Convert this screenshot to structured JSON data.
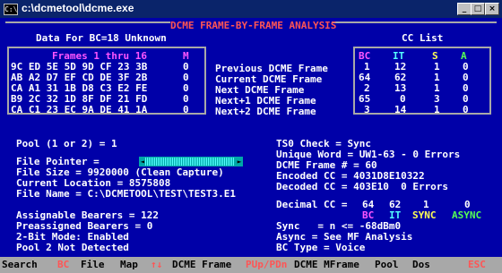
{
  "window": {
    "title": "c:\\dcmetool\\dcme.exe",
    "icon": "console-icon",
    "buttons": [
      "_",
      "□",
      "×"
    ]
  },
  "headline": "DCME FRAME-BY-FRAME ANALYSIS",
  "left_panel": {
    "heading": "Data For BC=18 Unknown",
    "frames_header": "Frames 1 thru 16",
    "m_header": "M",
    "rows": [
      {
        "bytes": "9C ED 5E 5D 9D CF 23 3B",
        "m": "0"
      },
      {
        "bytes": "AB A2 D7 EF CD DE 3F 2B",
        "m": "0"
      },
      {
        "bytes": "CA A1 31 1B D8 C3 E2 FE",
        "m": "0"
      },
      {
        "bytes": "B9 2C 32 1D 8F DF 21 FD",
        "m": "0"
      },
      {
        "bytes": "CA C1 23 EC 9A DE 41 1A",
        "m": "0"
      }
    ]
  },
  "frame_labels": [
    "Previous DCME Frame",
    "Current DCME Frame",
    "Next DCME Frame",
    "Next+1 DCME Frame",
    "Next+2 DCME Frame"
  ],
  "cc_list": {
    "heading": "CC List",
    "columns": [
      "BC",
      "IT",
      "S",
      "A"
    ],
    "rows": [
      [
        "1",
        "12",
        "1",
        "0"
      ],
      [
        "64",
        "62",
        "1",
        "0"
      ],
      [
        "2",
        "13",
        "1",
        "0"
      ],
      [
        "65",
        "0",
        "3",
        "0"
      ],
      [
        "3",
        "14",
        "1",
        "0"
      ]
    ]
  },
  "info_left": {
    "pool": "Pool (1 or 2) = 1",
    "file_pointer": "File Pointer =",
    "file_size": "File Size = 9920000 (Clean Capture)",
    "current_location": "Current Location = 8575808",
    "file_name": "File Name = C:\\DCMETOOL\\TEST\\TEST3.E1",
    "assignable": "Assignable Bearers = 122",
    "preassigned": "Preassigned Bearers = 0",
    "two_bit": "2-Bit Mode: Enabled",
    "pool2": "Pool 2 Not Detected"
  },
  "info_right": {
    "ts0": "TS0 Check = Sync",
    "unique_word": "Unique Word = UW1-63 - 0 Errors",
    "frame_num": "DCME Frame # = 60",
    "encoded": "Encoded CC = 4031D8E10322",
    "decoded": "Decoded CC = 403E10  0 Errors",
    "decimal_label": "Decimal CC =",
    "decimal_values": [
      "64",
      "62",
      "1",
      "0"
    ],
    "decimal_headers": [
      "BC",
      "IT",
      "SYNC",
      "ASYNC"
    ],
    "sync": "Sync   = n <= -68dBm0",
    "async": "Async = See MF Analysis",
    "bc_type": "BC Type = Voice"
  },
  "footer": [
    {
      "key": "Search",
      "label": ""
    },
    {
      "key": "BC",
      "label": "File"
    },
    {
      "key": "Map",
      "label": ""
    },
    {
      "key": "↑↓",
      "label": "DCME Frame"
    },
    {
      "key": "PUp/PDn",
      "label": "DCME MFrame"
    },
    {
      "key": "Pool",
      "label": ""
    },
    {
      "key": "Dos",
      "label": ""
    },
    {
      "key": "ESC",
      "label": ""
    }
  ],
  "colors": {
    "background": "#0000a8",
    "text": "#ffffff",
    "accent_red": "#ff5555",
    "magenta": "#ff55ff",
    "cyan": "#55ffff",
    "yellow": "#ffff55",
    "green": "#55ff55"
  }
}
